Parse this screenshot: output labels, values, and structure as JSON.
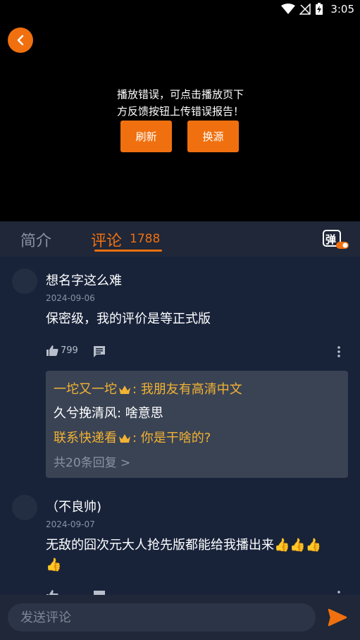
{
  "status_bar": {
    "time": "3:05"
  },
  "player": {
    "error_line1": "播放错误，可点击播放页下",
    "error_line2": "方反馈按钮上传错误报告！",
    "refresh_label": "刷新",
    "switch_source_label": "换源"
  },
  "tabs": {
    "intro_label": "简介",
    "comments_label": "评论",
    "comments_count": "1788",
    "danmaku_icon_text": "弹"
  },
  "comments": [
    {
      "name": "想名字这么难",
      "date": "2024-09-06",
      "text": "保密级，我的评价是等正式版",
      "likes": "799",
      "replies": [
        {
          "name": "一坨又一坨",
          "crown": true,
          "text": "我朋友有高清中文",
          "color": "gold"
        },
        {
          "name": "久兮挽清风",
          "crown": false,
          "text": "啥意思",
          "color": "white"
        },
        {
          "name": "联系快递看",
          "crown": true,
          "text": "你是干啥的?",
          "color": "gold"
        }
      ],
      "replies_more": "共20条回复 >"
    },
    {
      "name": "（不良帅)",
      "date": "2024-09-07",
      "text_line1": "无敌的囧次元大人抢先版都能给我播出来👍👍👍",
      "text_line2": "👍"
    }
  ],
  "bottom_bar": {
    "comment_placeholder": "发送评论"
  },
  "colors": {
    "accent": "#f0700f",
    "gold_name": "#f2b233",
    "panel_bg": "#18233a"
  }
}
